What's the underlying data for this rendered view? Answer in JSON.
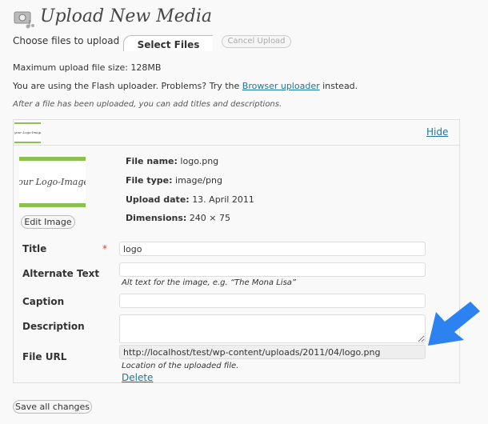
{
  "header": {
    "title": "Upload New Media",
    "icon": "media-icon"
  },
  "upload": {
    "choose_label": "Choose files to upload",
    "select_button": "Select Files",
    "cancel_button": "Cancel Upload",
    "max_size": "Maximum upload file size: 128MB",
    "flash_prefix": "You are using the Flash uploader. Problems? Try the ",
    "browser_link": "Browser uploader",
    "flash_suffix": " instead.",
    "after_note": "After a file has been uploaded, you can add titles and descriptions."
  },
  "item": {
    "thumb_text": "your Logo-Image",
    "hide_link": "Hide",
    "edit_image": "Edit Image",
    "info": [
      {
        "label": "File name:",
        "value": "logo.png"
      },
      {
        "label": "File type:",
        "value": "image/png"
      },
      {
        "label": "Upload date:",
        "value": "13. April 2011"
      },
      {
        "label": "Dimensions:",
        "value": "240 × 75"
      }
    ],
    "fields": {
      "title_label": "Title",
      "required_mark": "*",
      "title_value": "logo",
      "alt_label": "Alternate Text",
      "alt_value": "",
      "alt_hint": "Alt text for the image, e.g. “The Mona Lisa”",
      "caption_label": "Caption",
      "caption_value": "",
      "description_label": "Description",
      "description_value": "",
      "url_label": "File URL",
      "url_value": "http://localhost/test/wp-content/uploads/2011/04/logo.png",
      "url_hint": "Location of the uploaded file.",
      "delete_link": "Delete"
    }
  },
  "footer": {
    "save_button": "Save all changes"
  },
  "colors": {
    "accent_green": "#8cc152",
    "arrow_blue": "#2b82f0",
    "link": "#21759b"
  }
}
